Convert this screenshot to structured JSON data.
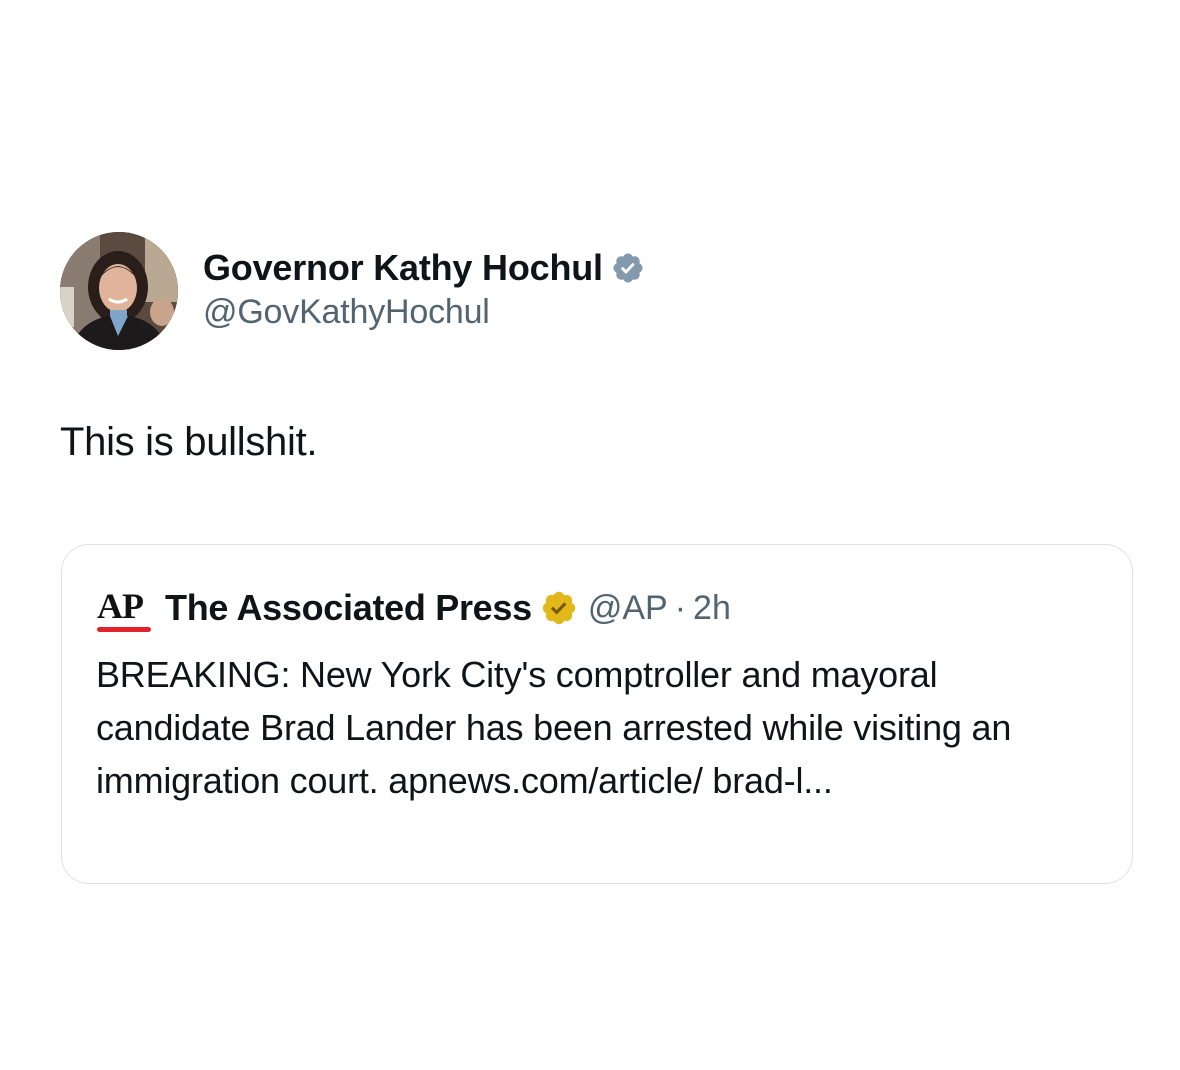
{
  "tweet": {
    "author": {
      "display_name": "Governor Kathy Hochul",
      "handle": "@GovKathyHochul",
      "verified_badge_color": "#829aab",
      "avatar_icon": "profile-photo"
    },
    "text": "This is bullshit.",
    "quoted_tweet": {
      "logo_text": "AP",
      "logo_accent_color": "#e0242c",
      "display_name": "The Associated Press",
      "verified_badge_color": "#e2b719",
      "handle": "@AP",
      "separator": "·",
      "time": "2h",
      "text": "BREAKING: New York City's comptroller and mayoral candidate Brad Lander has been arrested while visiting an immigration court. apnews.com/article/ brad-l..."
    }
  }
}
